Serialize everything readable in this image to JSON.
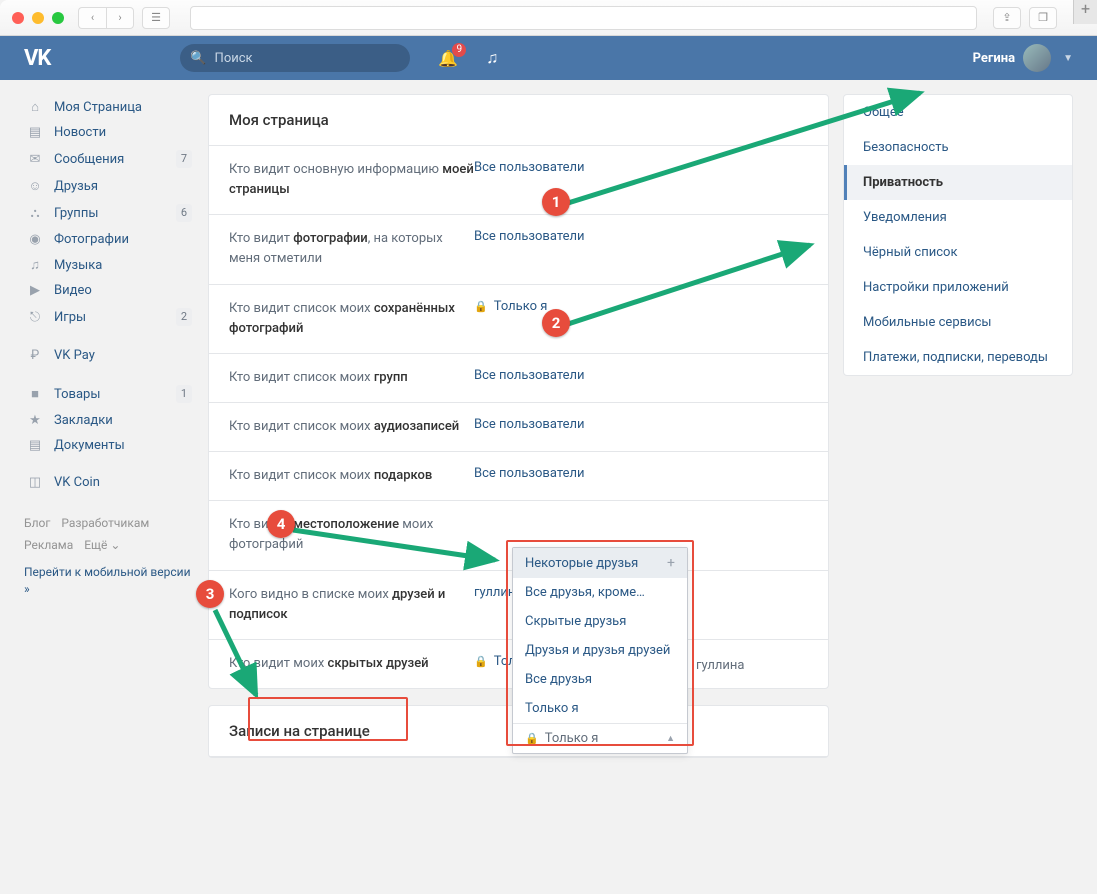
{
  "browser": {
    "reader_icon": "☰",
    "share_icon": "⇪",
    "tabs_icon": "❐",
    "plus": "+"
  },
  "header": {
    "logo": "VK",
    "search_placeholder": "Поиск",
    "notification_count": "9",
    "username": "Регина"
  },
  "leftnav": {
    "items": [
      {
        "icon": "⌂",
        "label": "Моя Страница",
        "count": ""
      },
      {
        "icon": "▤",
        "label": "Новости",
        "count": ""
      },
      {
        "icon": "✉",
        "label": "Сообщения",
        "count": "7"
      },
      {
        "icon": "☺",
        "label": "Друзья",
        "count": ""
      },
      {
        "icon": "⛬",
        "label": "Группы",
        "count": "6"
      },
      {
        "icon": "◉",
        "label": "Фотографии",
        "count": ""
      },
      {
        "icon": "♫",
        "label": "Музыка",
        "count": ""
      },
      {
        "icon": "▶",
        "label": "Видео",
        "count": ""
      },
      {
        "icon": "⎋",
        "label": "Игры",
        "count": "2"
      }
    ],
    "extra": [
      {
        "icon": "₽",
        "label": "VK Pay",
        "count": ""
      }
    ],
    "extra2": [
      {
        "icon": "■",
        "label": "Товары",
        "count": "1"
      },
      {
        "icon": "★",
        "label": "Закладки",
        "count": ""
      },
      {
        "icon": "▤",
        "label": "Документы",
        "count": ""
      }
    ],
    "extra3": [
      {
        "icon": "◫",
        "label": "VK Coin",
        "count": ""
      }
    ],
    "footer": {
      "blog": "Блог",
      "dev": "Разработчикам",
      "ads": "Реклама",
      "more": "Ещё ⌄",
      "mobile": "Перейти к мобильной версии »"
    }
  },
  "settings": {
    "title": "Моя страница",
    "rows": [
      {
        "pre": "Кто видит основную информацию ",
        "bold": "моей страницы",
        "value": "Все пользователи",
        "lock": false
      },
      {
        "pre": "Кто видит ",
        "bold": "фотографии",
        "post": ", на которых меня отметили",
        "value": "Все пользователи",
        "lock": false
      },
      {
        "pre": "Кто видит список моих ",
        "bold": "сохранённых фотографий",
        "value": "Только я",
        "lock": true
      },
      {
        "pre": "Кто видит список моих ",
        "bold": "групп",
        "value": "Все пользователи",
        "lock": false
      },
      {
        "pre": "Кто видит список моих ",
        "bold": "аудиозаписей",
        "value": "Все пользователи",
        "lock": false
      },
      {
        "pre": "Кто видит список моих ",
        "bold": "подарков",
        "value": "Все пользователи",
        "lock": false
      },
      {
        "pre": "Кто видит ",
        "bold": "местоположение",
        "post": " моих фотографий",
        "value": "",
        "lock": false
      },
      {
        "pre": "Кого видно в списке моих ",
        "bold": "друзей и подписок",
        "value": "гуллина",
        "lock": false
      },
      {
        "pre": "Кто видит моих ",
        "bold": "скрытых друзей",
        "value": "Только я",
        "lock": true
      }
    ],
    "section2_title": "Записи на странице"
  },
  "rightnav": {
    "items": [
      {
        "label": "Общее",
        "active": false
      },
      {
        "label": "Безопасность",
        "active": false
      },
      {
        "label": "Приватность",
        "active": true
      },
      {
        "label": "Уведомления",
        "active": false
      },
      {
        "label": "Чёрный список",
        "active": false
      },
      {
        "label": "Настройки приложений",
        "active": false
      },
      {
        "label": "Мобильные сервисы",
        "active": false
      },
      {
        "label": "Платежи, подписки, переводы",
        "active": false
      }
    ]
  },
  "dropdown": {
    "items": [
      "Некоторые друзья",
      "Все друзья, кроме…",
      "Скрытые друзья",
      "Друзья и друзья друзей",
      "Все друзья",
      "Только я"
    ],
    "selected": "Только я"
  },
  "annotation": {
    "n1": "1",
    "n2": "2",
    "n3": "3",
    "n4": "4"
  }
}
